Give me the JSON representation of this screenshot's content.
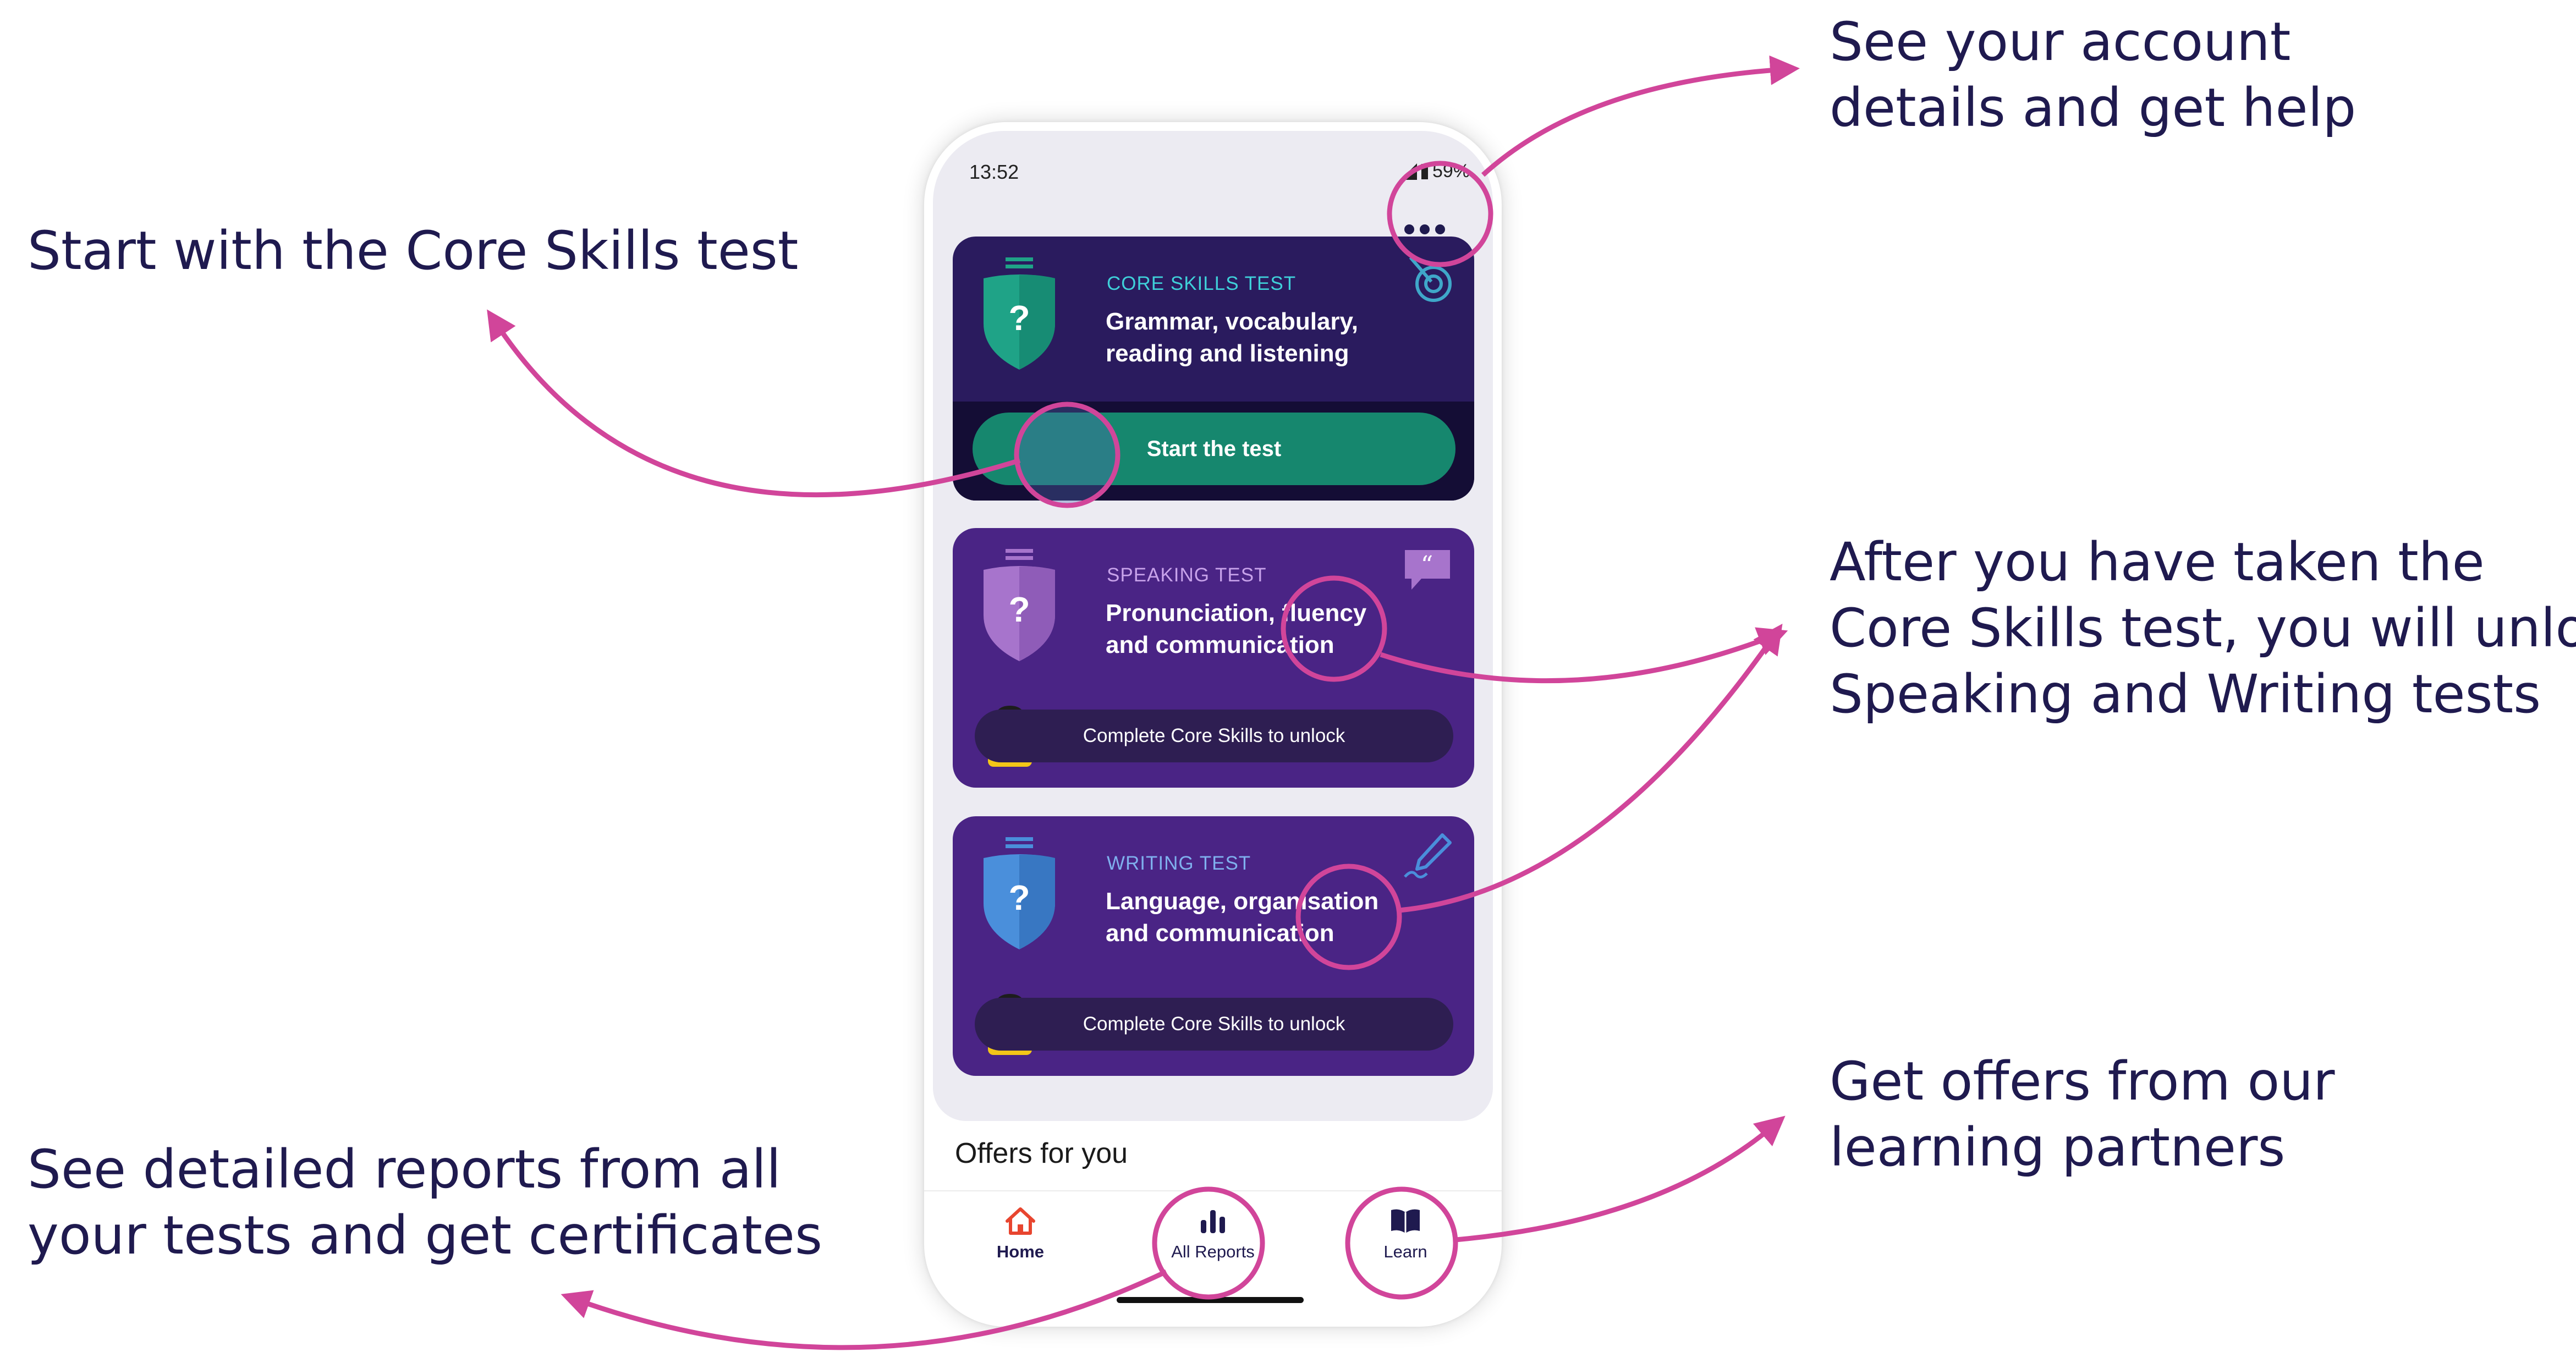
{
  "annotations": {
    "core_skills": "Start with the Core Skills test",
    "account_line1": "See your account",
    "account_line2": "details and get help",
    "unlock_line1": "After you have taken the",
    "unlock_line2": "Core Skills test, you will unlock",
    "unlock_line3": "Speaking and Writing tests",
    "offers_line1": "Get offers from our",
    "offers_line2": "learning partners",
    "reports_line1": "See detailed reports from all",
    "reports_line2": "your tests and get certificates"
  },
  "status_bar": {
    "time": "13:52",
    "battery": "59%"
  },
  "cards": {
    "core": {
      "eyebrow": "CORE SKILLS TEST",
      "title_line1": "Grammar, vocabulary,",
      "title_line2": "reading and listening",
      "button": "Start the test",
      "icon": "target-icon",
      "shield_mark": "?"
    },
    "speaking": {
      "eyebrow": "SPEAKING TEST",
      "title_line1": "Pronunciation, fluency",
      "title_line2": "and communication",
      "lock_text": "Complete Core Skills to unlock",
      "icon": "speech-bubble-icon",
      "shield_mark": "?"
    },
    "writing": {
      "eyebrow": "WRITING TEST",
      "title_line1": "Language, organisation",
      "title_line2": "and communication",
      "lock_text": "Complete Core Skills to unlock",
      "icon": "pen-icon",
      "shield_mark": "?"
    }
  },
  "offers_heading": "Offers for you",
  "nav": {
    "home": "Home",
    "reports": "All Reports",
    "learn": "Learn"
  },
  "colors": {
    "highlight": "#d1459a",
    "core_card": "#2a1b5e",
    "test_card": "#4a2485",
    "start_button": "#16876e",
    "text_dark": "#1f1a4f"
  }
}
